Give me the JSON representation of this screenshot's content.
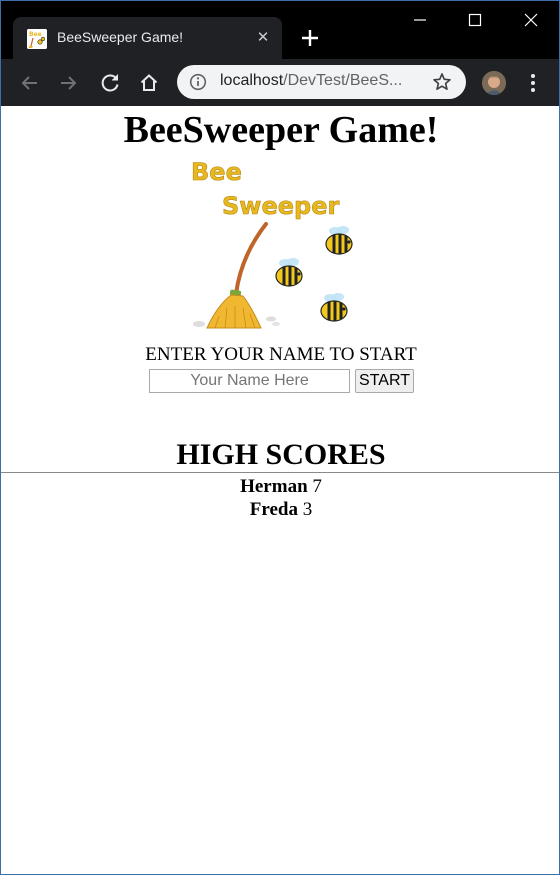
{
  "browser": {
    "tab_title": "BeeSweeper Game!",
    "url_host": "localhost",
    "url_path": "/DevTest/BeeS..."
  },
  "page": {
    "heading": "BeeSweeper Game!",
    "logo_text_line1": "Bee",
    "logo_text_line2": "Sweeper",
    "prompt": "ENTER YOUR NAME TO START",
    "name_placeholder": "Your Name Here",
    "name_value": "",
    "start_label": "START",
    "high_scores_heading": "HIGH SCORES",
    "scores": [
      {
        "name": "Herman",
        "score": "7"
      },
      {
        "name": "Freda",
        "score": "3"
      }
    ]
  },
  "colors": {
    "logo_yellow": "#e8b820",
    "broom_handle": "#c0642a",
    "broom_straw": "#f0b830",
    "bee_yellow": "#f2c81e"
  }
}
